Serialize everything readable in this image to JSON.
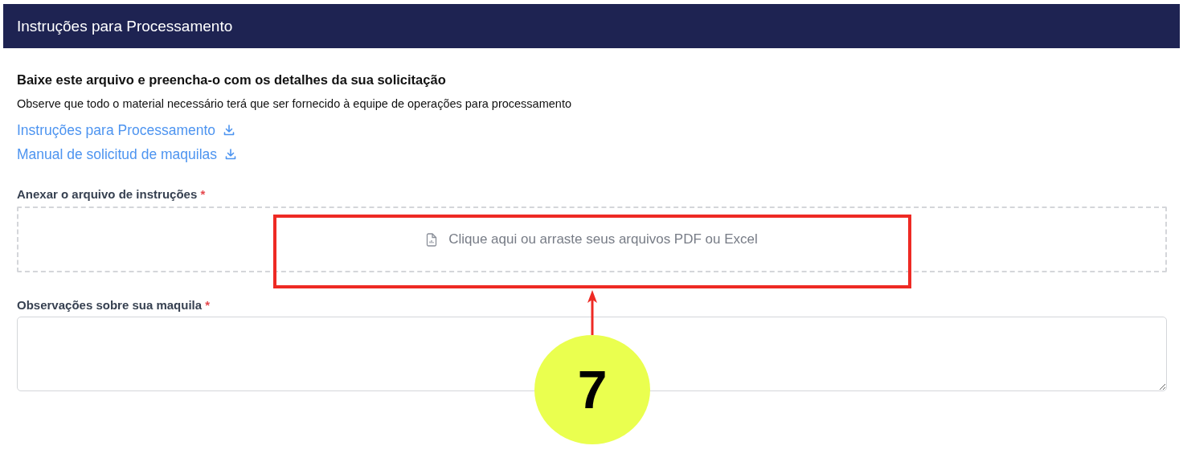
{
  "header": {
    "title": "Instruções para Processamento"
  },
  "intro": {
    "heading": "Baixe este arquivo e preencha-o com os detalhes da sua solicitação",
    "note": "Observe que todo o material necessário terá que ser fornecido à equipe de operações para processamento"
  },
  "downloads": [
    {
      "label": "Instruções para Processamento"
    },
    {
      "label": "Manual de solicitud de maquilas"
    }
  ],
  "upload": {
    "label": "Anexar o arquivo de instruções",
    "required_mark": "*",
    "prompt": "Clique aqui ou arraste seus arquivos PDF ou Excel"
  },
  "notes_field": {
    "label": "Observações sobre sua maquila",
    "required_mark": "*"
  },
  "annotation": {
    "label": "7"
  }
}
